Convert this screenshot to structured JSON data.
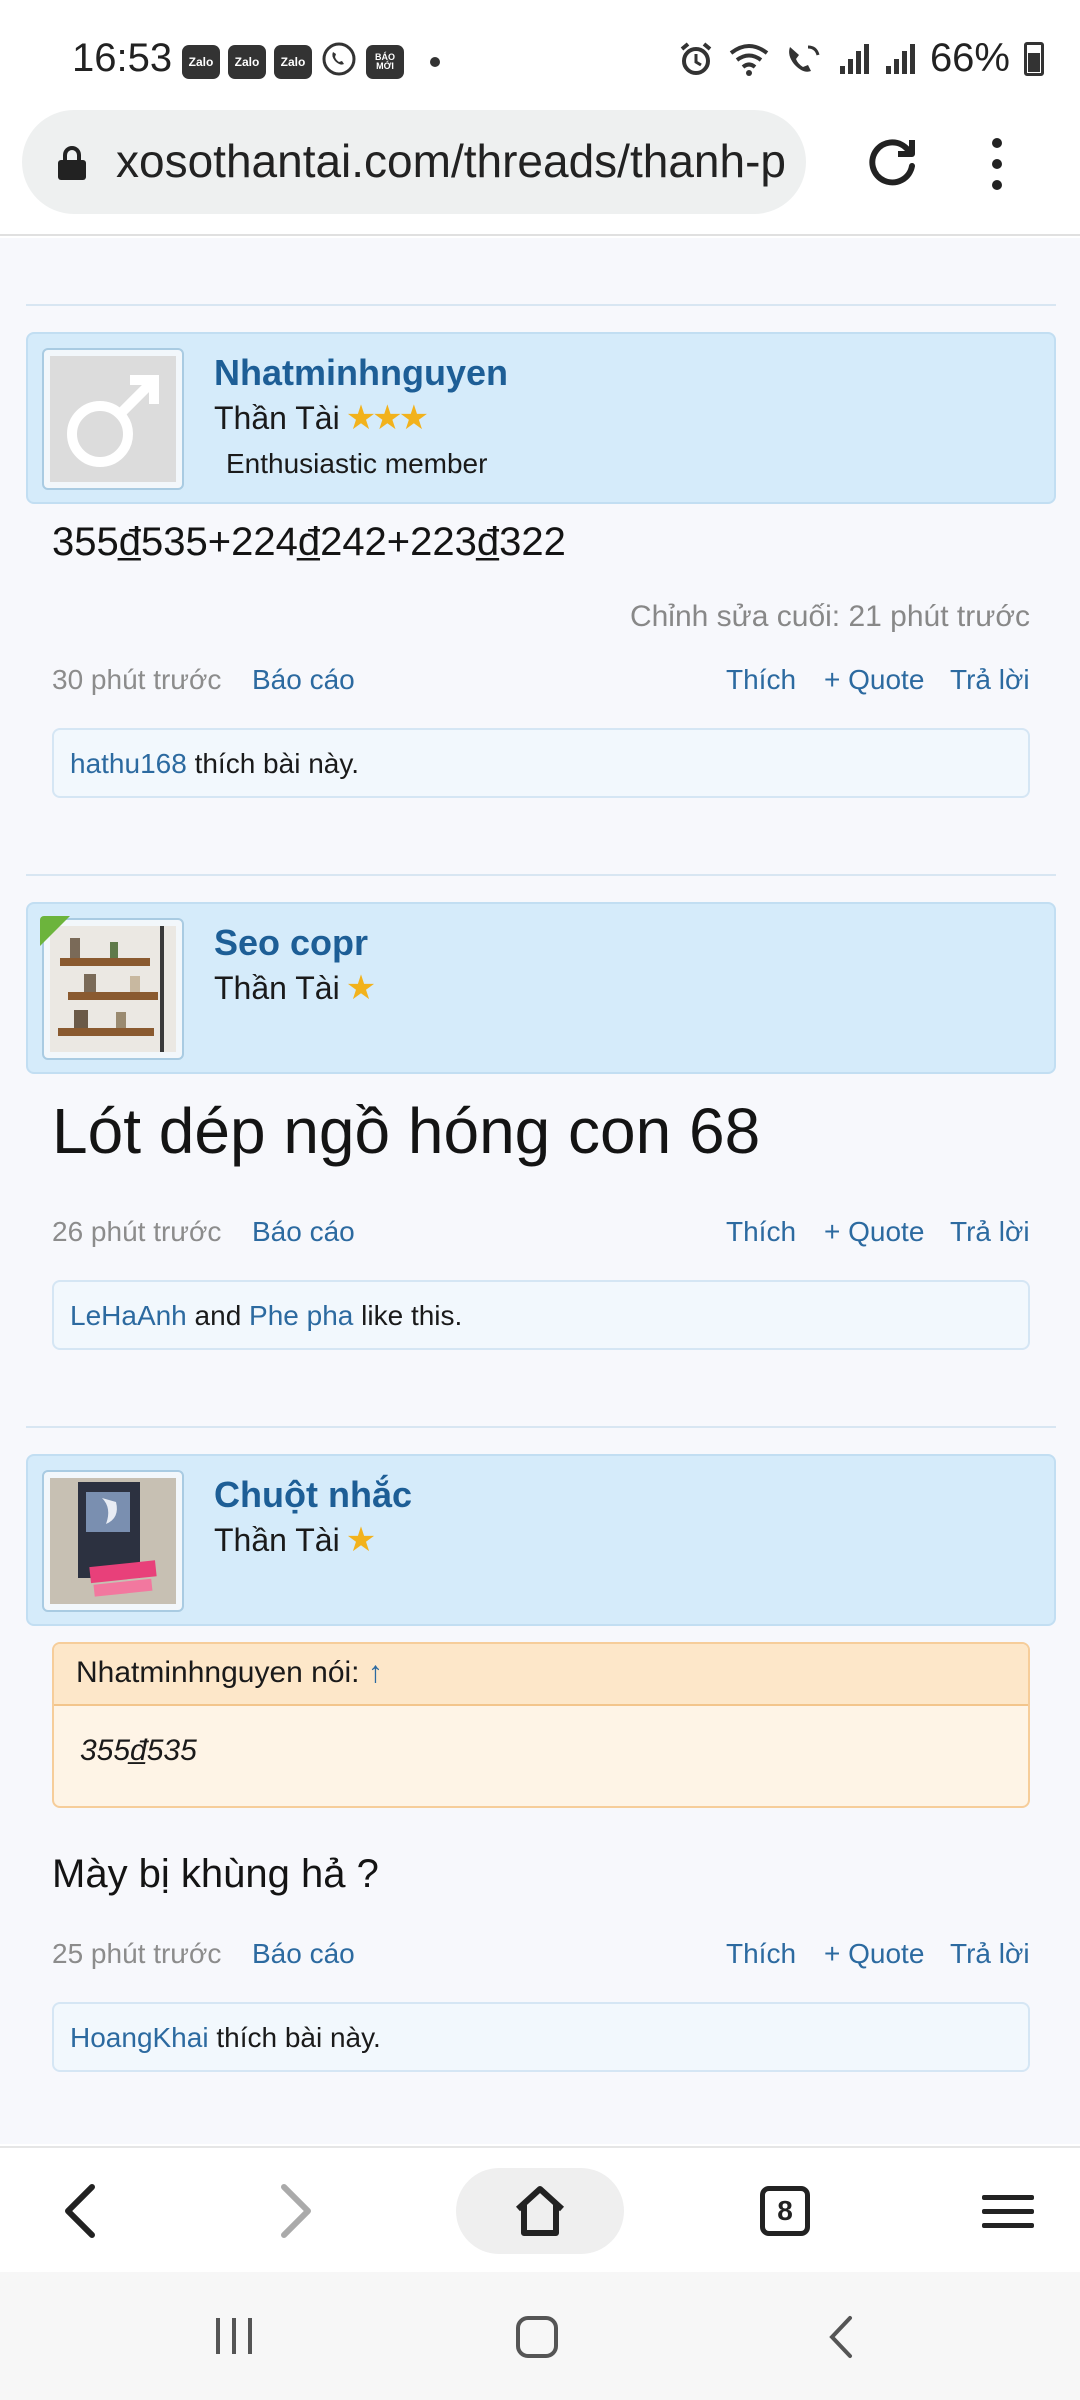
{
  "status_bar": {
    "time": "16:53",
    "notification_apps": [
      "Zalo",
      "Zalo",
      "Zalo",
      "viber-icon",
      "BÁO MỚI"
    ],
    "battery": "66%"
  },
  "browser": {
    "url": "xosothantai.com/threads/thanh-p",
    "tab_count": "8"
  },
  "posts": [
    {
      "author": "Nhatminhnguyen",
      "rank": "Thần Tài",
      "stars": "★★★",
      "blurb": "Enthusiastic member",
      "body": "355đ̲535+224đ̲242+223đ̲322",
      "edited": "Chỉnh sửa cuối: 21 phút trước",
      "time": "30 phút trước",
      "report": "Báo cáo",
      "like": "Thích",
      "quote": "+ Quote",
      "reply": "Trả lời",
      "likes_user": "hathu168",
      "likes_suffix": " thích bài này."
    },
    {
      "author": "Seo copr",
      "rank": "Thần Tài",
      "stars": "★",
      "body": "Lót dép ngồ hóng con 68",
      "time": "26 phút trước",
      "report": "Báo cáo",
      "like": "Thích",
      "quote": "+ Quote",
      "reply": "Trả lời",
      "likes_user1": "LeHaAnh",
      "likes_and": " and ",
      "likes_user2": "Phe pha",
      "likes_suffix": " like this."
    },
    {
      "author": "Chuột nhắc",
      "rank": "Thần Tài",
      "stars": "★",
      "quote_author": "Nhatminhnguyen nói: ",
      "quote_arrow": "↑",
      "quote_text": "355đ̲535",
      "body": "Mày bị khùng hả ?",
      "time": "25 phút trước",
      "report": "Báo cáo",
      "like": "Thích",
      "quote": "+ Quote",
      "reply": "Trả lời",
      "likes_user": "HoangKhai",
      "likes_suffix": " thích bài này."
    }
  ]
}
